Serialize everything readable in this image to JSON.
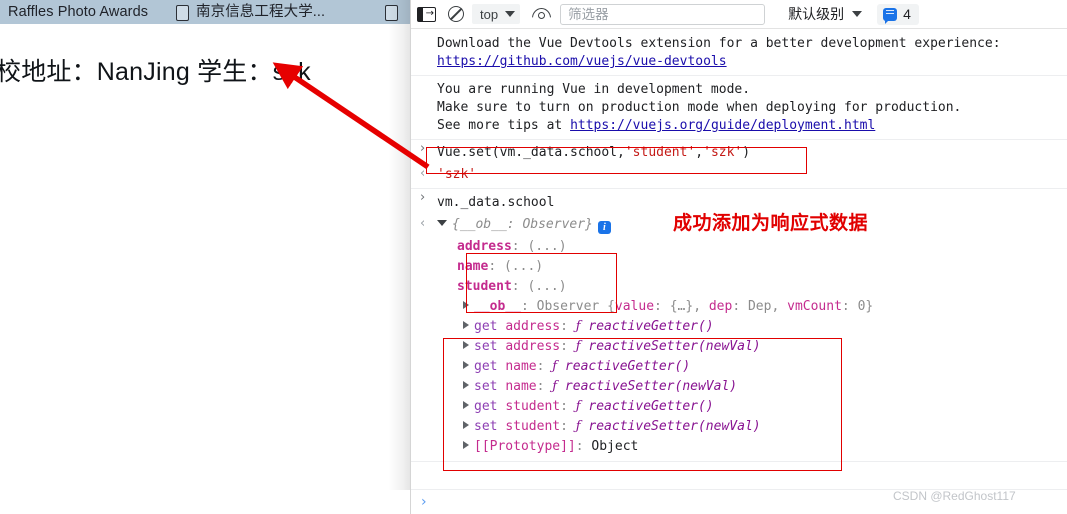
{
  "browser": {
    "tabs": [
      {
        "title": "Raffles Photo Awards",
        "has_favicon": false
      },
      {
        "title": "南京信息工程大学...",
        "has_favicon": true
      },
      {
        "title": "",
        "has_favicon": true
      }
    ],
    "page_text": "校地址：NanJing 学生：szk"
  },
  "devtools": {
    "toolbar": {
      "drawer_icon": "console-drawer-icon",
      "clear_icon": "clear-console-icon",
      "context_value": "top",
      "eye_icon": "live-expression-eye-icon",
      "filter_value": "",
      "filter_placeholder": "筛选器",
      "level_value": "默认级别",
      "message_badge_icon": "info-bubble-icon",
      "message_badge_count": "4"
    },
    "messages": [
      {
        "type": "info",
        "line1": "Download the Vue Devtools extension for a better development experience:",
        "link": "https://github.com/vuejs/vue-devtools"
      },
      {
        "type": "info",
        "line1": "You are running Vue in development mode.",
        "line2": "Make sure to turn on production mode when deploying for production.",
        "line3_prefix": "See more tips at ",
        "line3_link": "https://vuejs.org/guide/deployment.html"
      }
    ],
    "command": {
      "prompt": "›",
      "fn_start": "Vue.set(vm._data.school,",
      "arg1": "'student'",
      "comma": ",",
      "arg2": "'szk'",
      "fn_end": ")"
    },
    "result": {
      "prompt": "‹",
      "value": "'szk'"
    },
    "command2": {
      "prompt": "›",
      "text": "vm._data.school"
    },
    "object_header": {
      "prompt": "‹",
      "text": "{__ob__: Observer}",
      "info_icon": "info-icon"
    },
    "properties": [
      {
        "key": "address",
        "value": "(...)"
      },
      {
        "key": "name",
        "value": "(...)"
      },
      {
        "key": "student",
        "value": "(...)"
      }
    ],
    "ob_line": {
      "key": "__ob__",
      "class_name": "Observer",
      "brace_open": "{",
      "entries": [
        {
          "k": "value",
          "v": "{…}"
        },
        {
          "k": "dep",
          "v": "Dep"
        },
        {
          "k": "vmCount",
          "v": "0"
        }
      ],
      "brace_close": "}"
    },
    "accessors": [
      {
        "kind": "get",
        "name": "address",
        "fn": "reactiveGetter()"
      },
      {
        "kind": "set",
        "name": "address",
        "fn": "reactiveSetter(newVal)"
      },
      {
        "kind": "get",
        "name": "name",
        "fn": "reactiveGetter()"
      },
      {
        "kind": "set",
        "name": "name",
        "fn": "reactiveSetter(newVal)"
      },
      {
        "kind": "get",
        "name": "student",
        "fn": "reactiveGetter()"
      },
      {
        "kind": "set",
        "name": "student",
        "fn": "reactiveSetter(newVal)"
      }
    ],
    "prototype_line": {
      "key": "[[Prototype]]",
      "value": "Object"
    },
    "bottom_prompt": "›"
  },
  "annotations": {
    "note_text": "成功添加为响应式数据",
    "highlight_color": "#e10000",
    "arrow_color": "#e60000"
  },
  "watermark": "CSDN @RedGhost117"
}
